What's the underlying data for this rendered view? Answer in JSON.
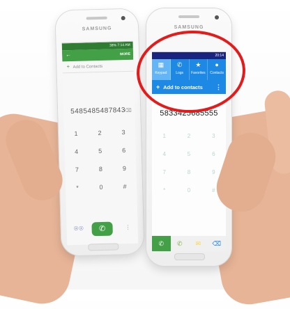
{
  "left_phone": {
    "brand": "SAMSUNG",
    "status": "38% 7:14 AM",
    "more": "MORE",
    "add_to_contacts": "Add to Contacts",
    "number": "5485485487843",
    "keys": [
      "1",
      "2",
      "3",
      "4",
      "5",
      "6",
      "7",
      "8",
      "9",
      "*",
      "0",
      "#"
    ]
  },
  "right_phone": {
    "brand": "SAMSUNG",
    "status": "20:14",
    "tabs": [
      {
        "label": "Keypad",
        "icon": "keypad-icon"
      },
      {
        "label": "Logs",
        "icon": "logs-icon"
      },
      {
        "label": "Favorites",
        "icon": "star-icon"
      },
      {
        "label": "Contacts",
        "icon": "person-icon"
      }
    ],
    "add_to_contacts": "Add to contacts",
    "number": "5833425685555",
    "keys": [
      "1",
      "2",
      "3",
      "4",
      "5",
      "6",
      "7",
      "8",
      "9",
      "*",
      "0",
      "#"
    ]
  },
  "highlight_color": "#e31b1b"
}
